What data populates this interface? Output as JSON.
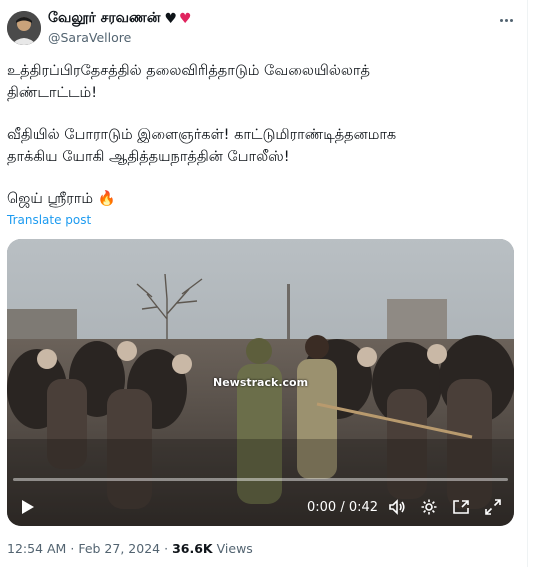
{
  "author": {
    "display_name": "வேலூர் சரவணன்",
    "badges": [
      "black-heart",
      "red-heart"
    ],
    "handle": "@SaraVellore"
  },
  "post": {
    "lines": [
      "உத்திரப்பிரதேசத்தில் தலைவிரித்தாடும் வேலையில்லாத்",
      "திண்டாட்டம்!",
      "வீதியில் போராடும் இளைஞர்கள்! காட்டுமிராண்டித்தனமாக",
      "தாக்கிய யோகி ஆதித்தயநாத்தின் போலீஸ்!",
      "ஜெய் ஸ்ரீராம் 🔥"
    ],
    "translate_label": "Translate post"
  },
  "video": {
    "watermark": "Newstrack.com",
    "time_display": "0:00 / 0:42",
    "progress": 0
  },
  "meta": {
    "time": "12:54 AM",
    "separator": "·",
    "date": "Feb 27, 2024",
    "views_count": "36.6K",
    "views_label": "Views"
  },
  "colors": {
    "link": "#1d9bf0",
    "secondary_text": "#536471",
    "heart_red": "#e0245e"
  }
}
